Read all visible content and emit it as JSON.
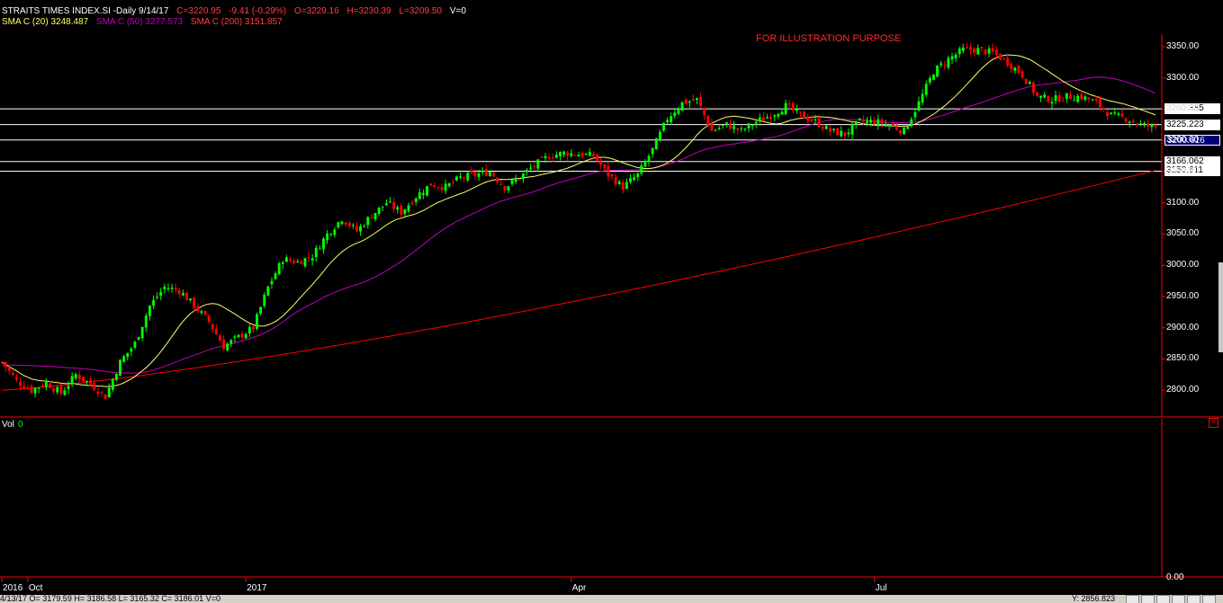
{
  "header": {
    "symbol": "STRAITS TIMES INDEX.SI -Daily  9/14/17",
    "close": "C=3220.95",
    "change": "-9.41 (-0.29%)",
    "open": "O=3229.16",
    "high": "H=3230.39",
    "low": "L=3209.50",
    "volume": "V=0",
    "sma20": "SMA C (20) 3248.487",
    "sma50": "SMA C (50) 3277.573",
    "sma200": "SMA C (200) 3151.857"
  },
  "note": "FOR ILLUSTRATION PURPOSE",
  "volume_panel": {
    "label": "Vol",
    "value": "0",
    "axis_zero": "0.00"
  },
  "footer": {
    "left": "4/13/17   O= 3179.59   H= 3186.58   L= 3165.32   C= 3186.01   V=0",
    "right": "Y: 2856.823"
  },
  "colors": {
    "up": "#00ff00",
    "down": "#ff0000",
    "sma20": "#ffff66",
    "sma50": "#c000c0",
    "sma200": "#ff0000",
    "levels": "#ffffff"
  },
  "chart_data": {
    "type": "candlestick",
    "title": "STRAITS TIMES INDEX.SI -Daily",
    "ylim": [
      2760,
      3370
    ],
    "yticks": [
      2800,
      2850,
      2900,
      2950,
      3000,
      3050,
      3100,
      3150,
      3200,
      3250,
      3300,
      3350
    ],
    "ytick_labels": [
      "2800.00",
      "2850.00",
      "2900.00",
      "2950.00",
      "3000.00",
      "3050.00",
      "3100.00",
      "3150.00",
      "3200.00",
      "3250.00",
      "3300.00",
      "3350.00"
    ],
    "x_labels": [
      {
        "label": "2016",
        "bar": 0
      },
      {
        "label": "Oct",
        "bar": 7
      },
      {
        "label": "2017",
        "bar": 66
      },
      {
        "label": "Apr",
        "bar": 154
      },
      {
        "label": "Jul",
        "bar": 236
      }
    ],
    "levels": [
      {
        "value": 3250.385,
        "label": "3250.385",
        "style": "white"
      },
      {
        "value": 3225.223,
        "label": "3225.223",
        "style": "white"
      },
      {
        "value": 3200.616,
        "label": "3200.616",
        "style": "blue"
      },
      {
        "value": 3166.062,
        "label": "3166.062",
        "style": "white"
      },
      {
        "value": 3150.611,
        "label": "3150.611",
        "style": "white"
      }
    ],
    "anchors": [
      [
        0,
        2845
      ],
      [
        4,
        2815
      ],
      [
        8,
        2800
      ],
      [
        12,
        2812
      ],
      [
        16,
        2795
      ],
      [
        20,
        2825
      ],
      [
        24,
        2810
      ],
      [
        28,
        2790
      ],
      [
        32,
        2845
      ],
      [
        36,
        2875
      ],
      [
        40,
        2935
      ],
      [
        44,
        2965
      ],
      [
        48,
        2960
      ],
      [
        52,
        2935
      ],
      [
        56,
        2910
      ],
      [
        60,
        2870
      ],
      [
        64,
        2885
      ],
      [
        68,
        2900
      ],
      [
        72,
        2965
      ],
      [
        76,
        3010
      ],
      [
        80,
        3005
      ],
      [
        84,
        3015
      ],
      [
        88,
        3050
      ],
      [
        92,
        3075
      ],
      [
        96,
        3055
      ],
      [
        100,
        3080
      ],
      [
        104,
        3100
      ],
      [
        108,
        3085
      ],
      [
        112,
        3110
      ],
      [
        116,
        3130
      ],
      [
        120,
        3125
      ],
      [
        124,
        3140
      ],
      [
        128,
        3145
      ],
      [
        132,
        3150
      ],
      [
        136,
        3125
      ],
      [
        140,
        3140
      ],
      [
        144,
        3160
      ],
      [
        148,
        3175
      ],
      [
        152,
        3180
      ],
      [
        156,
        3178
      ],
      [
        160,
        3175
      ],
      [
        164,
        3145
      ],
      [
        168,
        3125
      ],
      [
        172,
        3145
      ],
      [
        176,
        3185
      ],
      [
        180,
        3235
      ],
      [
        184,
        3260
      ],
      [
        188,
        3265
      ],
      [
        192,
        3215
      ],
      [
        196,
        3225
      ],
      [
        200,
        3215
      ],
      [
        204,
        3230
      ],
      [
        208,
        3240
      ],
      [
        212,
        3255
      ],
      [
        216,
        3240
      ],
      [
        220,
        3230
      ],
      [
        224,
        3215
      ],
      [
        228,
        3210
      ],
      [
        232,
        3230
      ],
      [
        236,
        3230
      ],
      [
        240,
        3225
      ],
      [
        244,
        3215
      ],
      [
        248,
        3260
      ],
      [
        252,
        3310
      ],
      [
        256,
        3330
      ],
      [
        260,
        3345
      ],
      [
        264,
        3345
      ],
      [
        268,
        3340
      ],
      [
        272,
        3325
      ],
      [
        276,
        3305
      ],
      [
        280,
        3270
      ],
      [
        284,
        3265
      ],
      [
        288,
        3270
      ],
      [
        292,
        3270
      ],
      [
        296,
        3260
      ],
      [
        300,
        3240
      ],
      [
        304,
        3235
      ],
      [
        308,
        3225
      ],
      [
        312,
        3221
      ]
    ],
    "series": [
      {
        "name": "SMA C (20)",
        "value": 3248.487,
        "period": 20
      },
      {
        "name": "SMA C (50)",
        "value": 3277.573,
        "period": 50
      },
      {
        "name": "SMA C (200)",
        "value": 3151.857,
        "period": 200
      }
    ]
  }
}
